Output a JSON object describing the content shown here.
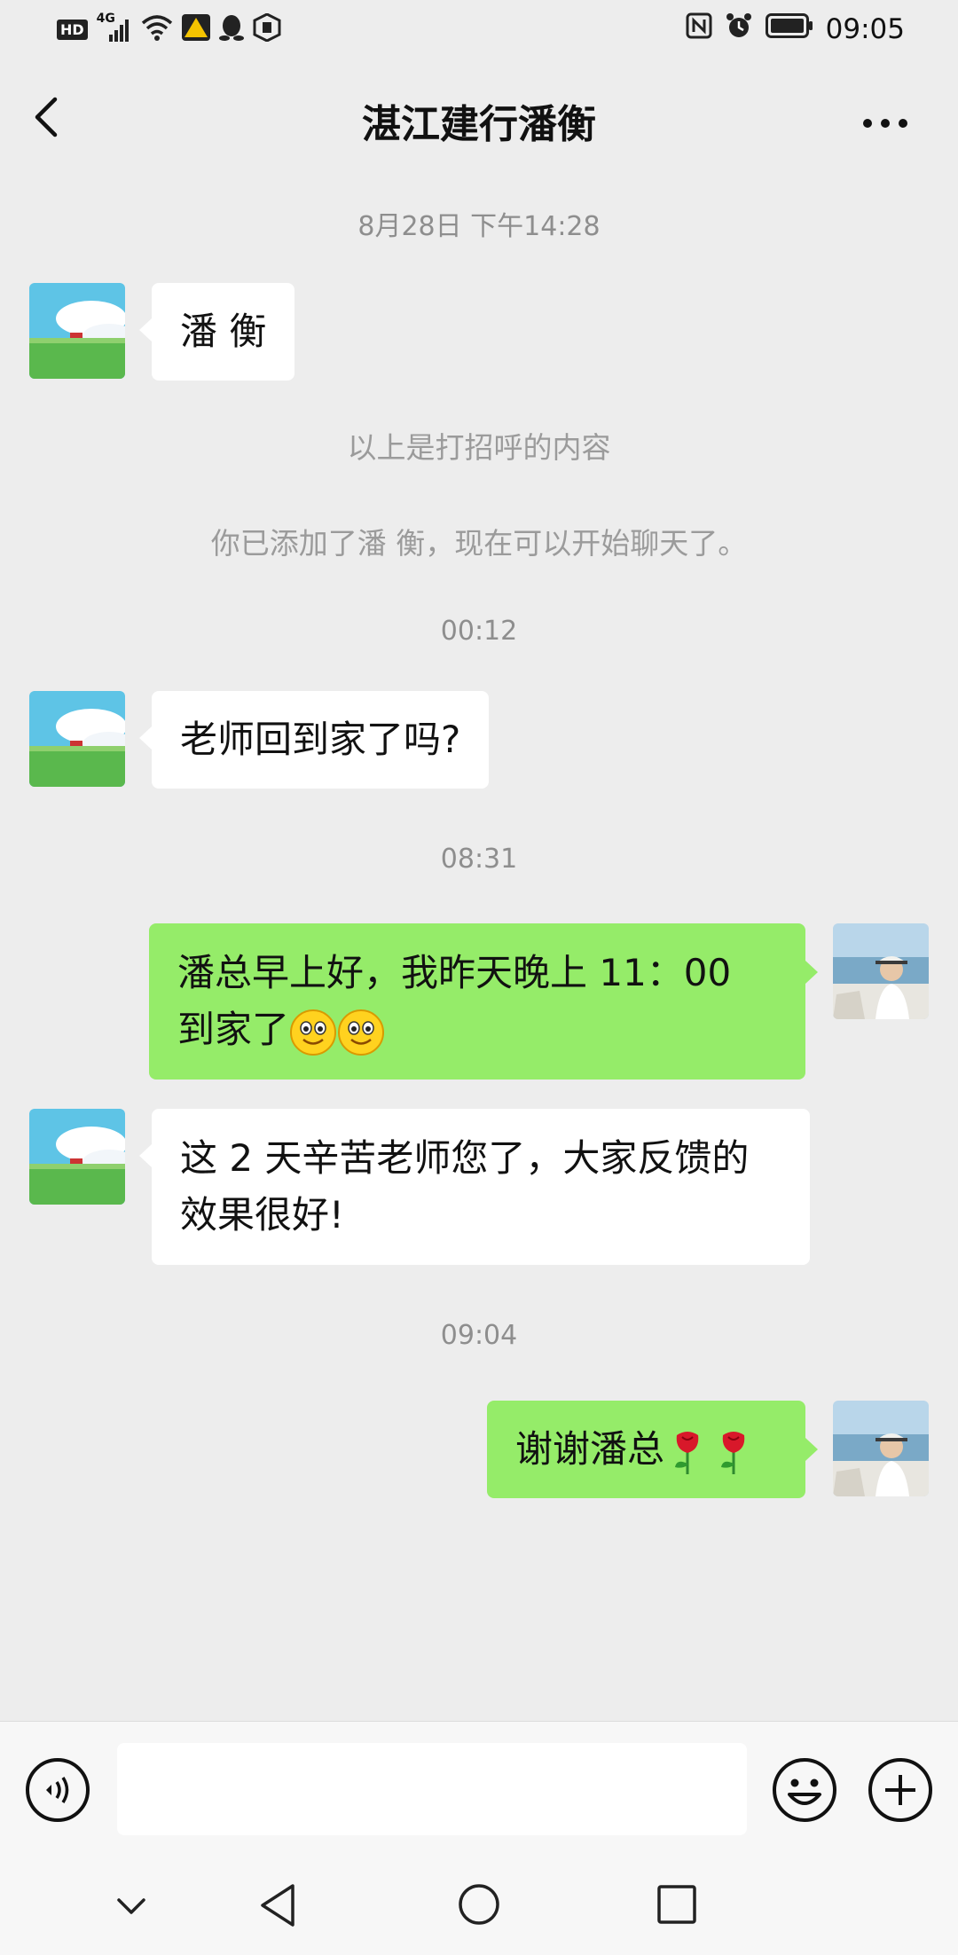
{
  "status_bar": {
    "hd": "HD",
    "network": "4G",
    "time": "09:05"
  },
  "header": {
    "title": "湛江建行潘衡"
  },
  "messages": {
    "time1": "8月28日 下午14:28",
    "msg1": "潘 衡",
    "system1": "以上是打招呼的内容",
    "system2": "你已添加了潘 衡，现在可以开始聊天了。",
    "time2": "00:12",
    "msg2": "老师回到家了吗?",
    "time3": "08:31",
    "msg3_line1": "潘总早上好，我昨天晚上 11：00",
    "msg3_line2": "到家了",
    "msg4_line1": "这 2 天辛苦老师您了，大家反馈的",
    "msg4_line2": "效果很好!",
    "time4": "09:04",
    "msg5": "谢谢潘总"
  },
  "colors": {
    "background": "#ededed",
    "incoming_bubble": "#ffffff",
    "outgoing_bubble": "#95ec69",
    "timestamp": "#8e8e8e"
  },
  "icons": {
    "back": "chevron-left-icon",
    "more": "more-dots-icon",
    "voice": "voice-icon",
    "emoji": "emoji-icon",
    "plus": "plus-icon"
  }
}
